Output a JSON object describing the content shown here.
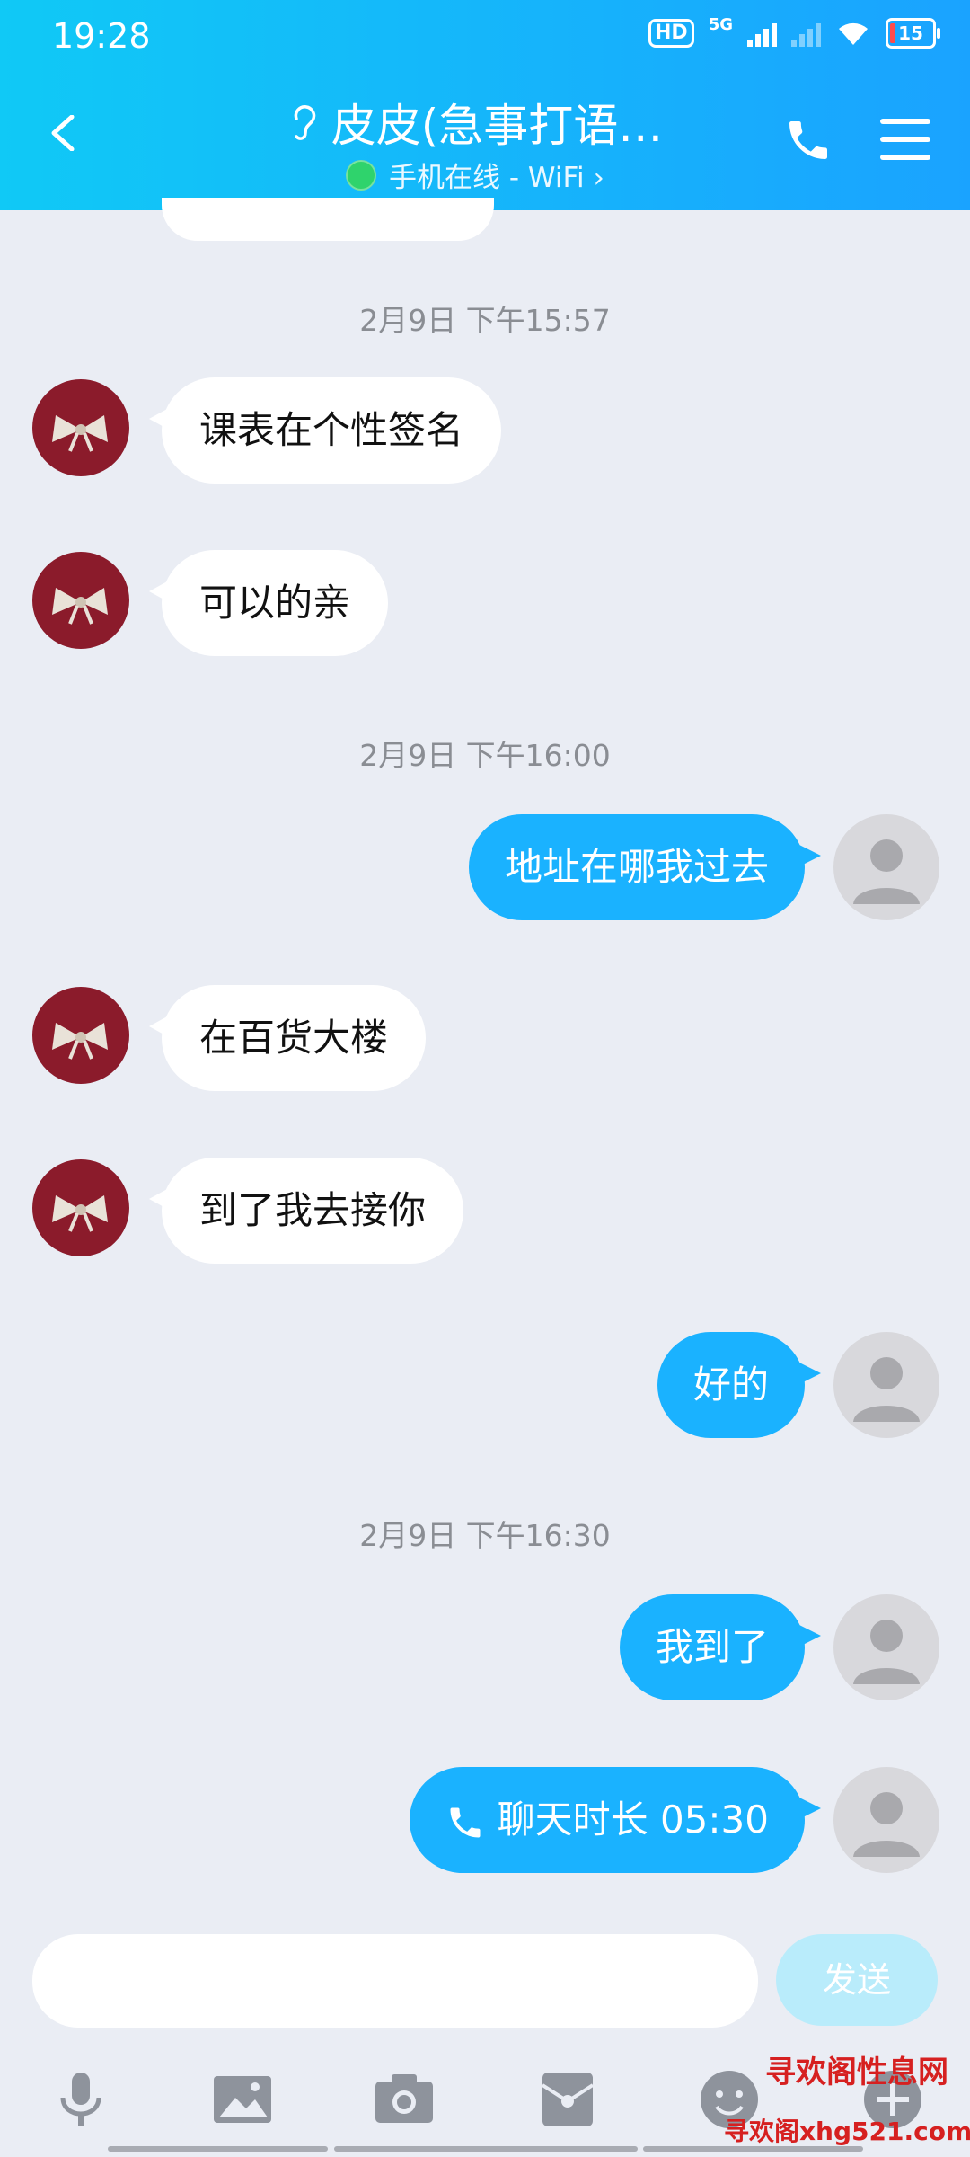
{
  "status": {
    "time": "19:28",
    "hd": "HD",
    "network": "5G",
    "battery": "15"
  },
  "header": {
    "title": "皮皮(急事打语…",
    "subtitle": "手机在线 - WiFi ›"
  },
  "messages": [
    {
      "kind": "time",
      "text": "2月9日 下午15:57"
    },
    {
      "kind": "in",
      "text": "课表在个性签名"
    },
    {
      "kind": "in",
      "text": "可以的亲"
    },
    {
      "kind": "time",
      "text": "2月9日 下午16:00"
    },
    {
      "kind": "out",
      "text": "地址在哪我过去"
    },
    {
      "kind": "in",
      "text": "在百货大楼"
    },
    {
      "kind": "in",
      "text": "到了我去接你"
    },
    {
      "kind": "out",
      "text": "好的"
    },
    {
      "kind": "time",
      "text": "2月9日 下午16:30"
    },
    {
      "kind": "out",
      "text": "我到了"
    },
    {
      "kind": "out",
      "text": "聊天时长 05:30"
    }
  ],
  "input": {
    "placeholder": "",
    "send_label": "发送"
  },
  "toolbar": {
    "items": [
      "microphone-icon",
      "image-icon",
      "camera-icon",
      "red-packet-icon",
      "emoji-icon",
      "plus-icon"
    ]
  },
  "watermark": {
    "line1": "寻欢阁性息网",
    "line2": "寻欢阁xhg521.com"
  },
  "colors": {
    "header_from": "#10c9f6",
    "header_to": "#1aa3ff",
    "bubble_out": "#1ab2ff",
    "bubble_in": "#ffffff",
    "background": "#eaedf4"
  }
}
